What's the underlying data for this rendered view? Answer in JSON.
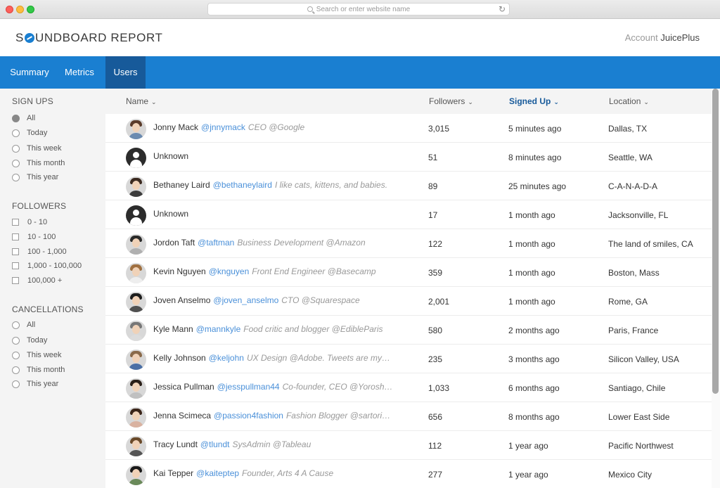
{
  "browser": {
    "url_placeholder": "Search or enter website name"
  },
  "header": {
    "logo_prefix": "S",
    "logo_suffix": "UNDBOARD REPORT",
    "account_label": "Account",
    "account_name": "JuicePlus"
  },
  "nav": {
    "tabs": [
      {
        "label": "Summary",
        "active": false
      },
      {
        "label": "Metrics",
        "active": false
      },
      {
        "label": "Users",
        "active": true
      }
    ]
  },
  "sidebar": {
    "signups": {
      "title": "SIGN UPS",
      "options": [
        "All",
        "Today",
        "This week",
        "This month",
        "This year"
      ],
      "selected": "All"
    },
    "followers": {
      "title": "FOLLOWERS",
      "options": [
        "0 - 10",
        "10 - 100",
        "100 - 1,000",
        "1,000 - 100,000",
        "100,000 +"
      ]
    },
    "cancellations": {
      "title": "CANCELLATIONS",
      "options": [
        "All",
        "Today",
        "This week",
        "This month",
        "This year"
      ]
    }
  },
  "table": {
    "headers": {
      "name": "Name",
      "followers": "Followers",
      "signed_up": "Signed Up",
      "location": "Location"
    },
    "sorted_column": "signed_up",
    "rows": [
      {
        "name": "Jonny Mack",
        "handle": "@jnnymack",
        "bio": "CEO @Google",
        "followers": "3,015",
        "signed_up": "5 minutes ago",
        "location": "Dallas, TX",
        "avatar": "photo"
      },
      {
        "name": "Unknown",
        "handle": "",
        "bio": "",
        "followers": "51",
        "signed_up": "8 minutes ago",
        "location": "Seattle, WA",
        "avatar": "unknown"
      },
      {
        "name": "Bethaney Laird",
        "handle": "@bethaneylaird",
        "bio": "I like cats, kittens, and babies.",
        "followers": "89",
        "signed_up": "25 minutes ago",
        "location": "C-A-N-A-D-A",
        "avatar": "photo"
      },
      {
        "name": "Unknown",
        "handle": "",
        "bio": "",
        "followers": "17",
        "signed_up": "1 month ago",
        "location": "Jacksonville, FL",
        "avatar": "unknown"
      },
      {
        "name": "Jordon Taft",
        "handle": "@taftman",
        "bio": "Business Development @Amazon",
        "followers": "122",
        "signed_up": "1 month ago",
        "location": "The land of smiles, CA",
        "avatar": "photo"
      },
      {
        "name": "Kevin Nguyen",
        "handle": "@knguyen",
        "bio": "Front End Engineer @Basecamp",
        "followers": "359",
        "signed_up": "1 month ago",
        "location": "Boston, Mass",
        "avatar": "photo"
      },
      {
        "name": "Joven Anselmo",
        "handle": "@joven_anselmo",
        "bio": "CTO @Squarespace",
        "followers": "2,001",
        "signed_up": "1 month ago",
        "location": "Rome, GA",
        "avatar": "photo"
      },
      {
        "name": "Kyle Mann",
        "handle": "@mannkyle",
        "bio": "Food critic and blogger @EdibleParis",
        "followers": "580",
        "signed_up": "2 months ago",
        "location": "Paris, France",
        "avatar": "photo"
      },
      {
        "name": "Kelly Johnson",
        "handle": "@keljohn",
        "bio": "UX Design @Adobe. Tweets are my…",
        "followers": "235",
        "signed_up": "3 months ago",
        "location": "Silicon Valley, USA",
        "avatar": "photo"
      },
      {
        "name": "Jessica Pullman",
        "handle": "@jesspullman44",
        "bio": "Co-founder, CEO @Yorosh…",
        "followers": "1,033",
        "signed_up": "6 months ago",
        "location": "Santiago, Chile",
        "avatar": "photo"
      },
      {
        "name": "Jenna Scimeca",
        "handle": "@passion4fashion",
        "bio": "Fashion Blogger @sartori…",
        "followers": "656",
        "signed_up": "8 months ago",
        "location": "Lower East Side",
        "avatar": "photo"
      },
      {
        "name": "Tracy Lundt",
        "handle": "@tlundt",
        "bio": "SysAdmin @Tableau",
        "followers": "112",
        "signed_up": "1 year ago",
        "location": "Pacific Northwest",
        "avatar": "photo"
      },
      {
        "name": "Kai Tepper",
        "handle": "@kaiteptep",
        "bio": "Founder, Arts 4 A Cause",
        "followers": "277",
        "signed_up": "1 year ago",
        "location": "Mexico City",
        "avatar": "photo"
      }
    ]
  },
  "colors": {
    "brand_blue": "#1a7fd1",
    "active_tab": "#175a9a",
    "handle_link": "#4a90d9"
  }
}
